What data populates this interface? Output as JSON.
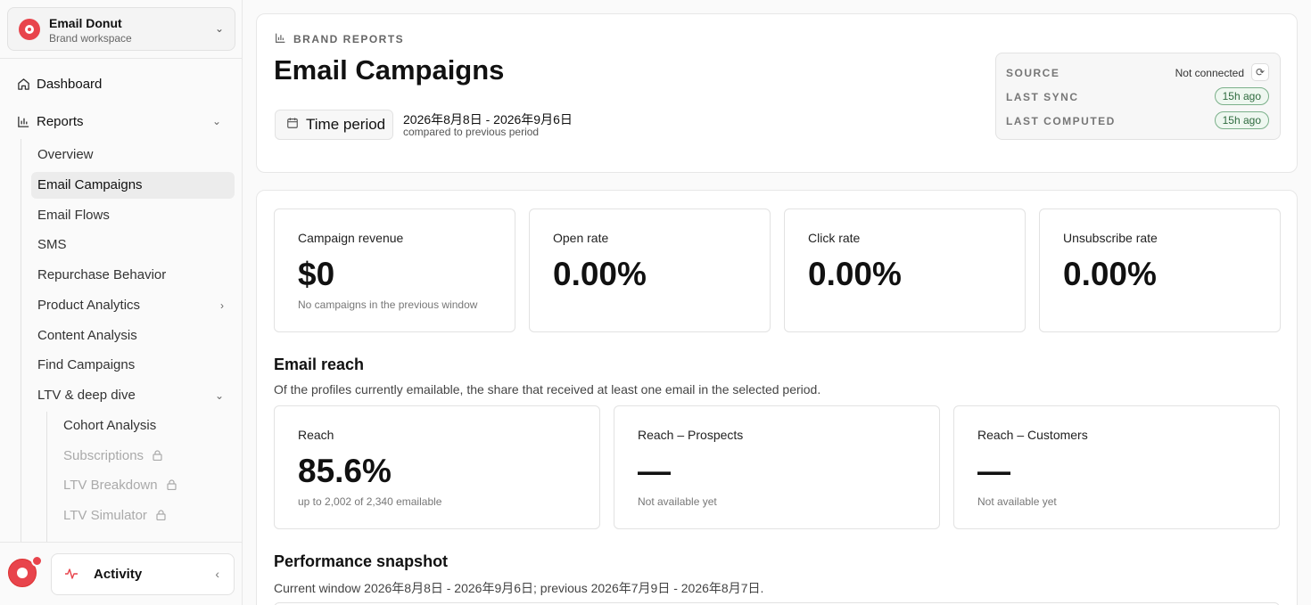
{
  "workspace": {
    "name": "Email Donut",
    "subtitle": "Brand workspace"
  },
  "nav": {
    "dashboard": "Dashboard",
    "reports": "Reports",
    "report_items": [
      "Overview",
      "Email Campaigns",
      "Email Flows",
      "SMS",
      "Repurchase Behavior",
      "Product Analytics",
      "Content Analysis",
      "Find Campaigns",
      "LTV & deep dive"
    ],
    "ltv_items": [
      "Cohort Analysis",
      "Subscriptions",
      "LTV Breakdown",
      "LTV Simulator"
    ],
    "active_item": "Email Campaigns"
  },
  "activity": {
    "label": "Activity"
  },
  "header": {
    "eyebrow": "BRAND REPORTS",
    "title": "Email Campaigns",
    "time_period_label": "Time period",
    "date_range": "2026年8月8日 - 2026年9月6日",
    "comparison": "compared to previous period",
    "status": {
      "source_label": "SOURCE",
      "source_value": "Not connected",
      "last_sync_label": "LAST SYNC",
      "last_sync_value": "15h ago",
      "last_computed_label": "LAST COMPUTED",
      "last_computed_value": "15h ago"
    }
  },
  "kpis": [
    {
      "label": "Campaign revenue",
      "value": "$0",
      "note": "No campaigns in the previous window"
    },
    {
      "label": "Open rate",
      "value": "0.00%",
      "note": ""
    },
    {
      "label": "Click rate",
      "value": "0.00%",
      "note": ""
    },
    {
      "label": "Unsubscribe rate",
      "value": "0.00%",
      "note": ""
    }
  ],
  "reach": {
    "title": "Email reach",
    "description": "Of the profiles currently emailable, the share that received at least one email in the selected period.",
    "cards": [
      {
        "label": "Reach",
        "value": "85.6%",
        "note": "up to 2,002 of 2,340 emailable"
      },
      {
        "label": "Reach – Prospects",
        "value": "—",
        "note": "Not available yet"
      },
      {
        "label": "Reach – Customers",
        "value": "—",
        "note": "Not available yet"
      }
    ]
  },
  "performance": {
    "title": "Performance snapshot",
    "description": "Current window 2026年8月8日 - 2026年9月6日; previous 2026年7月9日 - 2026年8月7日."
  },
  "colors": {
    "brand": "#e8444c",
    "success": "#2f6b3f",
    "active_bg": "#ececec"
  }
}
